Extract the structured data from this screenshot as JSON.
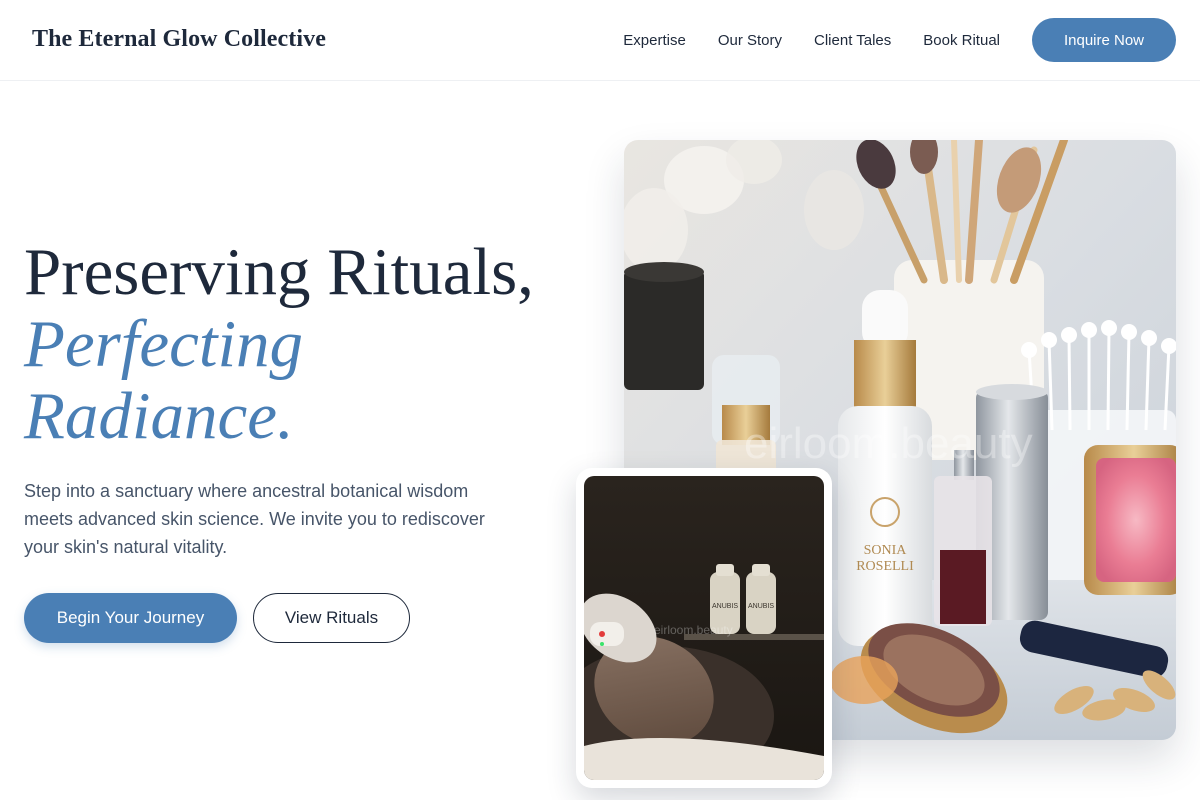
{
  "header": {
    "brand": "The Eternal Glow Collective",
    "nav": [
      {
        "label": "Expertise"
      },
      {
        "label": "Our Story"
      },
      {
        "label": "Client Tales"
      },
      {
        "label": "Book Ritual"
      }
    ],
    "cta_label": "Inquire Now"
  },
  "hero": {
    "title_line1": "Preserving Rituals,",
    "title_line2": "Perfecting",
    "title_line3": "Radiance.",
    "subtitle": "Step into a sanctuary where ancestral botanical wisdom meets advanced skin science. We invite you to rediscover your skin's natural vitality.",
    "primary_button": "Begin Your Journey",
    "secondary_button": "View Rituals"
  },
  "images": {
    "main_watermark": "eirloom.beauty",
    "inset_watermark": "eirloom.beauty"
  },
  "colors": {
    "accent": "#4a7fb5",
    "text_dark": "#1e293b",
    "text_muted": "#475569"
  }
}
